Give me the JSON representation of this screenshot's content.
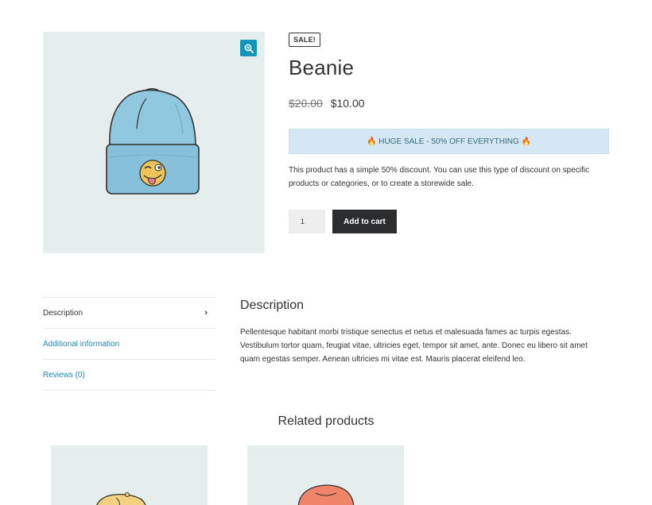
{
  "product": {
    "badge": "SALE!",
    "title": "Beanie",
    "regular_price": "$20.00",
    "sale_price": "$10.00",
    "notice": "🔥 HUGE SALE - 50% OFF EVERYTHING 🔥",
    "short_description": "This product has a simple 50% discount. You can use this type of discount on specific products or categories, or to create a storewide sale.",
    "quantity": "1",
    "add_to_cart_label": "Add to cart",
    "zoom_icon": "zoom-in-icon"
  },
  "tabs": [
    {
      "label": "Description"
    },
    {
      "label": "Additional information"
    },
    {
      "label": "Reviews (0)"
    }
  ],
  "description_panel": {
    "title": "Description",
    "text": "Pellentesque habitant morbi tristique senectus et netus et malesuada fames ac turpis egestas. Vestibulum tortor quam, feugiat vitae, ultricies eget, tempor sit amet, ante. Donec eu libero sit amet quam egestas semper. Aenean ultricies mi vitae est. Mauris placerat eleifend leo."
  },
  "related": {
    "title": "Related products"
  },
  "colors": {
    "accent": "#1295b6",
    "link": "#1c8ab0",
    "button_dark": "#2b2d2f",
    "notice_bg": "#d3e8f2",
    "image_bg": "#e6eded"
  }
}
